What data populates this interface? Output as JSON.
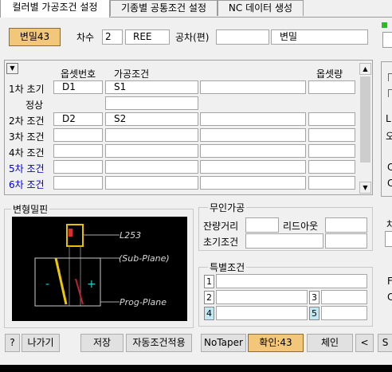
{
  "tabs": [
    {
      "label": "컬러별 가공조건 설정"
    },
    {
      "label": "기종별 공통조건 설정"
    },
    {
      "label": "NC 데이터 생성"
    }
  ],
  "header": {
    "mold_button": "변밀43",
    "order_label": "차수",
    "order_value": "2",
    "code_value": "REE",
    "tolerance_label": "공차(편)",
    "tolerance_value": "",
    "mill_value": "변밀"
  },
  "grid": {
    "col_offset_no": "옵셋번호",
    "col_condition": "가공조건",
    "col_offset_amount": "옵셋량",
    "rows": [
      {
        "label": "1차 초기",
        "offset_no": "D1",
        "condition": "S1",
        "blue": false
      },
      {
        "label": "정상",
        "offset_no": "",
        "condition": "",
        "blue": false
      },
      {
        "label": "2차 조건",
        "offset_no": "D2",
        "condition": "S2",
        "blue": false
      },
      {
        "label": "3차 조건",
        "offset_no": "",
        "condition": "",
        "blue": false
      },
      {
        "label": "4차 조건",
        "offset_no": "",
        "condition": "",
        "blue": false
      },
      {
        "label": "5차 조건",
        "offset_no": "",
        "condition": "",
        "blue": true
      },
      {
        "label": "6차 조건",
        "offset_no": "",
        "condition": "",
        "blue": true
      }
    ]
  },
  "preview": {
    "title": "변형밀핀",
    "label_l": "L253",
    "label_sub": "(Sub-Plane)",
    "label_prog": "Prog-Plane",
    "minus": "-",
    "plus": "+"
  },
  "unmanned": {
    "title": "무인가공",
    "remaining_label": "잔량거리",
    "leadout_label": "리드아웃",
    "initial_label": "초기조건"
  },
  "special": {
    "title": "특별조건",
    "nums": [
      "1",
      "2",
      "3",
      "4",
      "5"
    ]
  },
  "footer": {
    "help": "?",
    "exit": "나가기",
    "save": "저장",
    "auto": "자동조건적용",
    "notaper": "NoTaper",
    "confirm": "확인:43",
    "chain": "체인",
    "prev": "<",
    "s": "S"
  },
  "right_partial": {
    "l": "L",
    "o": "오",
    "c1": "C",
    "c2": "C",
    "ch": "차",
    "f": "F",
    "c3": "C"
  },
  "colors": {
    "highlight": "#f2c77a",
    "cyan": "#bfe9f5",
    "green": "#22c022",
    "preview_bg": "#000000"
  }
}
